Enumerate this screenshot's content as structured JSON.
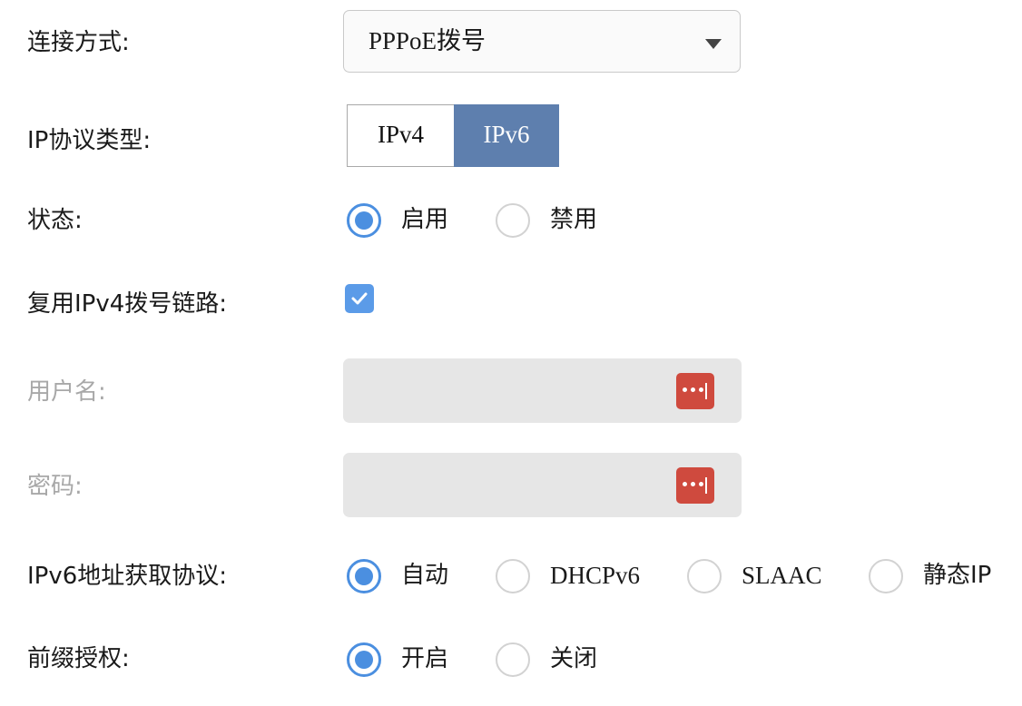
{
  "labels": {
    "connection_type": "连接方式:",
    "ip_protocol_type": "IP协议类型:",
    "status": "状态:",
    "reuse_ipv4_link": "复用IPv4拨号链路:",
    "username": "用户名:",
    "password": "密码:",
    "ipv6_addr_protocol": "IPv6地址获取协议:",
    "prefix_delegation": "前缀授权:"
  },
  "connection_type": {
    "selected": "PPPoE拨号"
  },
  "ip_protocol": {
    "options": [
      "IPv4",
      "IPv6"
    ],
    "selected": "IPv6"
  },
  "status": {
    "options": [
      "启用",
      "禁用"
    ],
    "selected": "启用"
  },
  "reuse_ipv4_link": {
    "checked": true
  },
  "username": {
    "value": "",
    "icon": "password-manager-icon"
  },
  "password": {
    "value": "",
    "icon": "password-manager-icon"
  },
  "ipv6_addr_protocol": {
    "options": [
      "自动",
      "DHCPv6",
      "SLAAC",
      "静态IP"
    ],
    "selected": "自动"
  },
  "prefix_delegation": {
    "options": [
      "开启",
      "关闭"
    ],
    "selected": "开启"
  },
  "colors": {
    "accent": "#4b8fe0",
    "segment_active": "#5e7fae",
    "key_icon": "#cf4a3e",
    "disabled_text": "#a8a8a8",
    "input_bg": "#e6e6e6"
  }
}
